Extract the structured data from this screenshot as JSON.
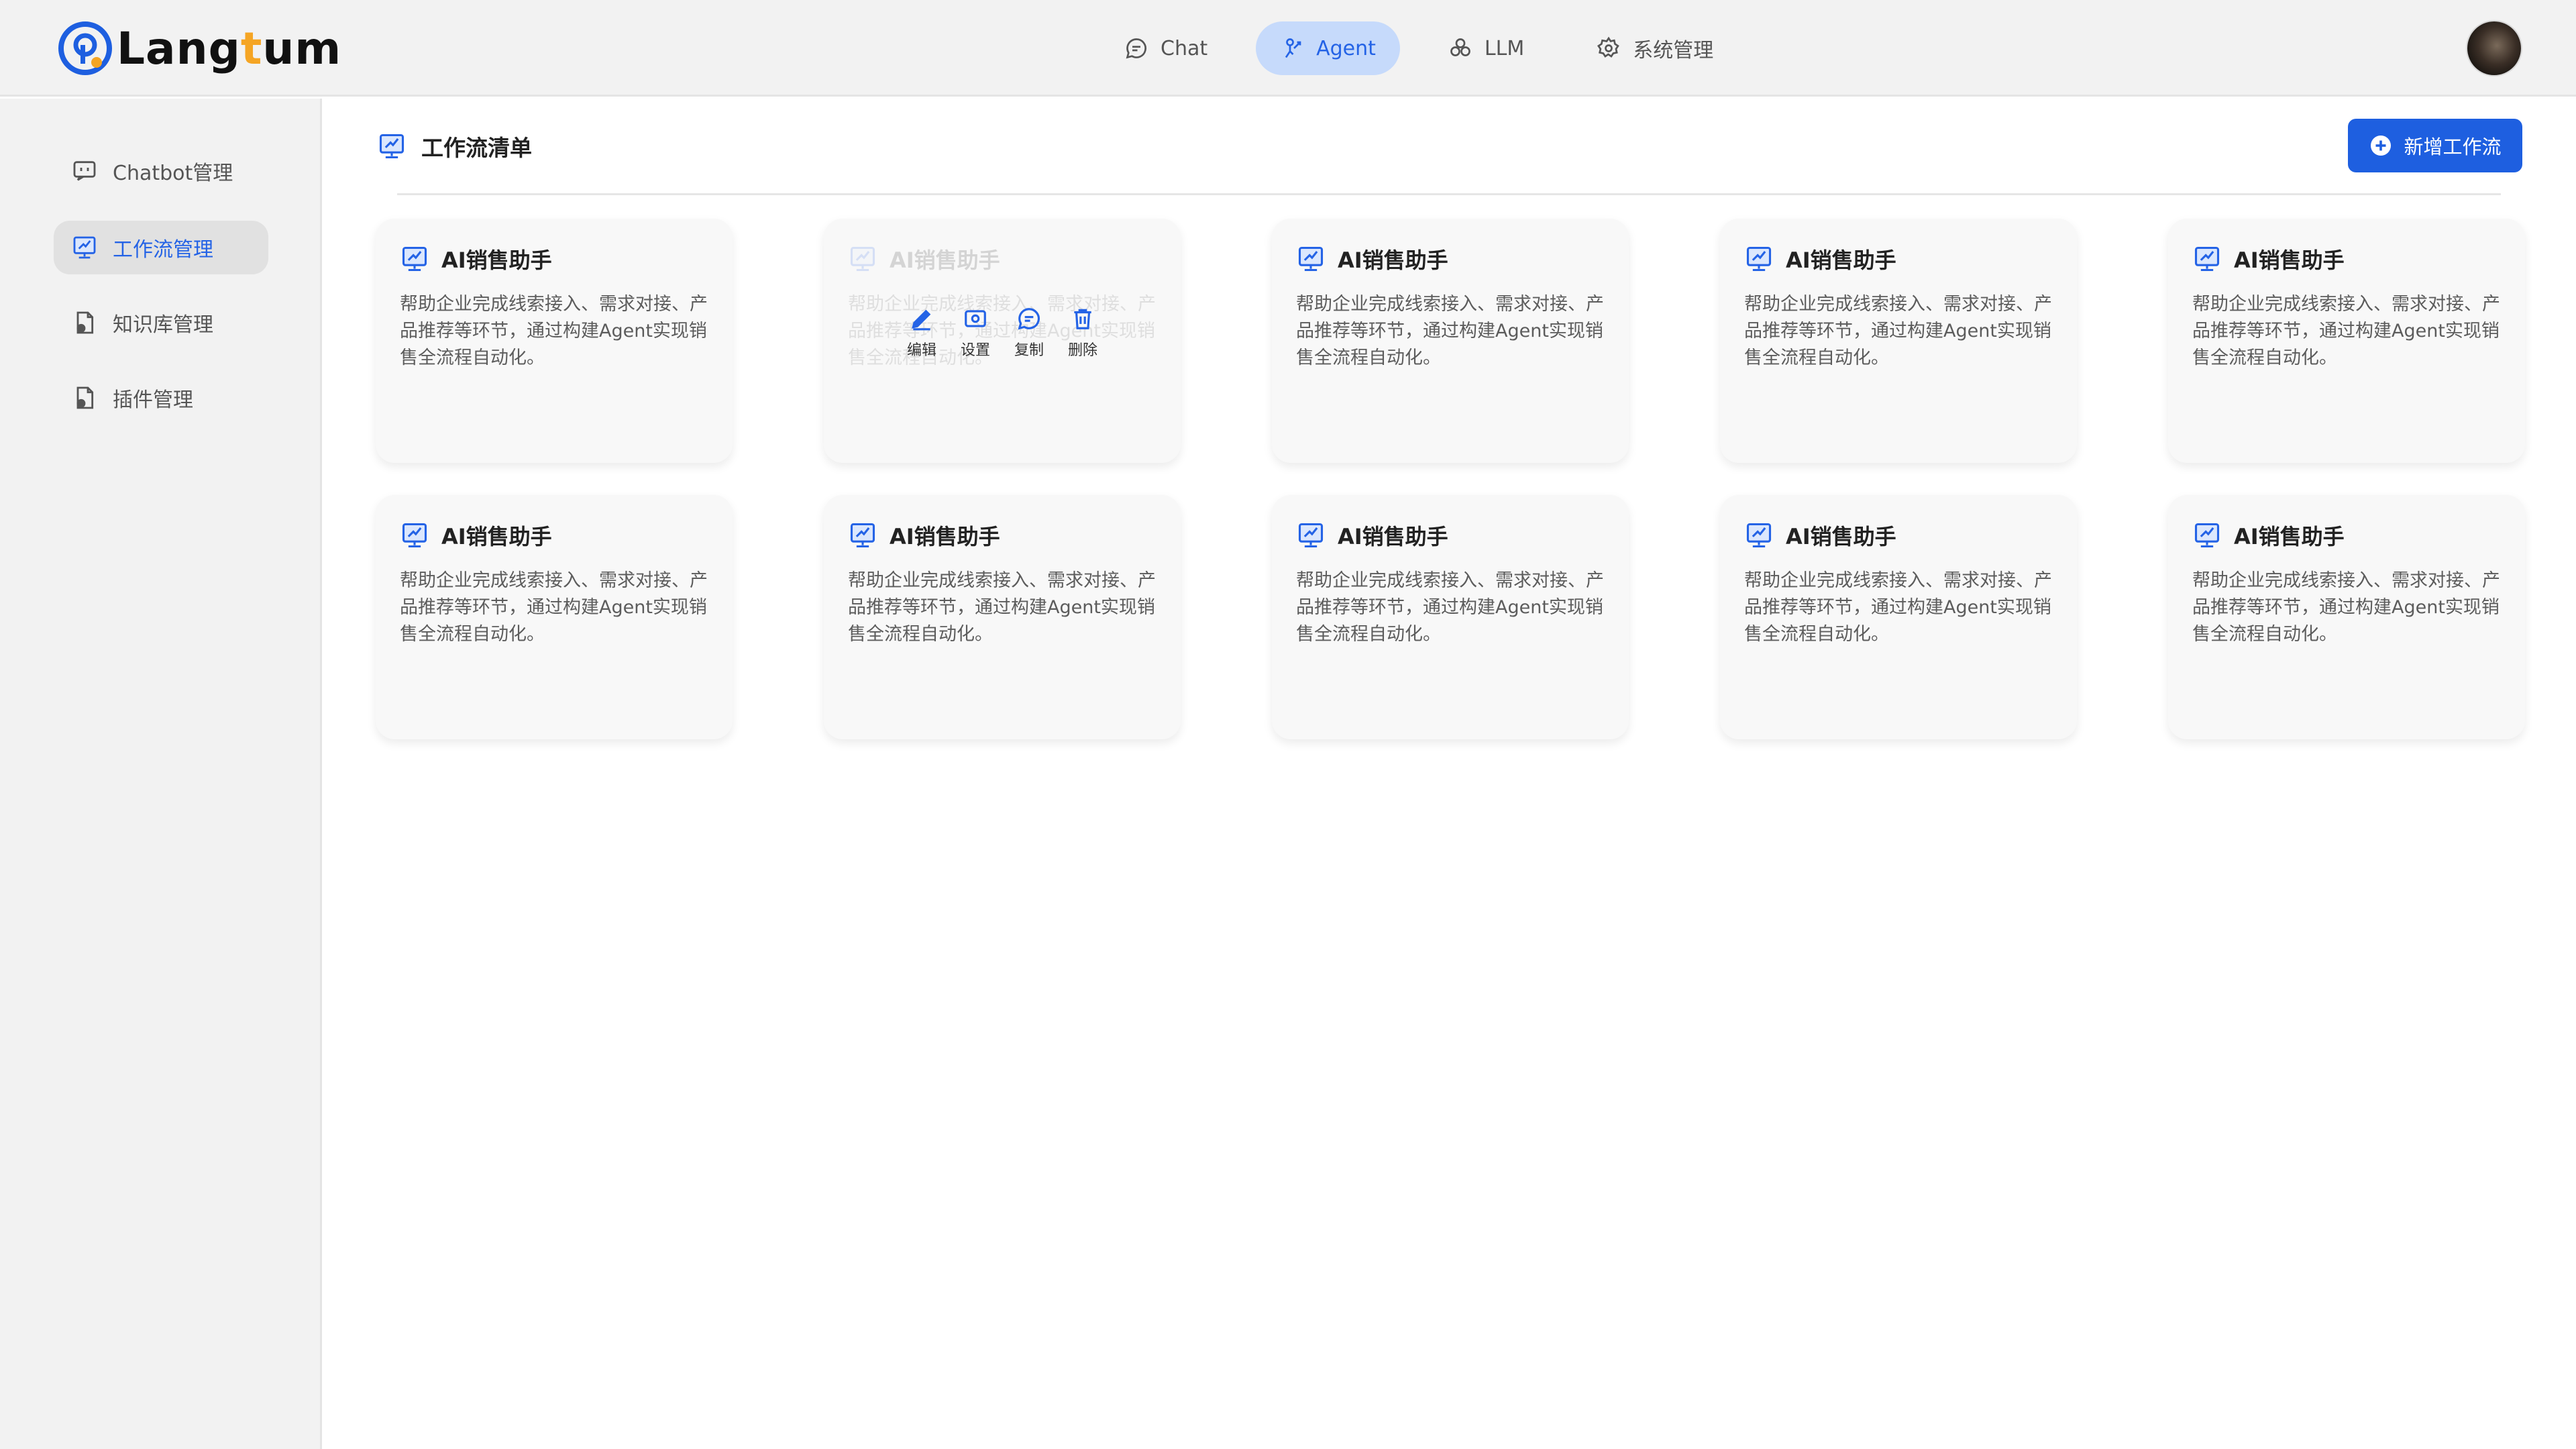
{
  "app": {
    "logo_text_main": "Lang",
    "logo_text_accent": "t",
    "logo_text_tail": "um"
  },
  "nav": {
    "items": [
      {
        "label": "Chat",
        "icon": "chat-bubble-icon"
      },
      {
        "label": "Agent",
        "icon": "agent-icon",
        "active": true
      },
      {
        "label": "LLM",
        "icon": "cluster-icon"
      },
      {
        "label": "系统管理",
        "icon": "gear-icon"
      }
    ]
  },
  "sidebar": {
    "items": [
      {
        "label": "Chatbot管理",
        "icon": "chatbot-icon"
      },
      {
        "label": "工作流管理",
        "icon": "workflow-icon",
        "active": true
      },
      {
        "label": "知识库管理",
        "icon": "knowledge-base-icon"
      },
      {
        "label": "插件管理",
        "icon": "plugin-icon"
      }
    ]
  },
  "main": {
    "title": "工作流清单",
    "add_button_label": "新增工作流"
  },
  "card_actions": {
    "edit": "编辑",
    "settings": "设置",
    "copy": "复制",
    "delete": "删除"
  },
  "cards": [
    {
      "title": "AI销售助手",
      "desc": "帮助企业完成线索接入、需求对接、产品推荐等环节，通过构建Agent实现销售全流程自动化。"
    },
    {
      "title": "AI销售助手",
      "desc": "帮助企业完成线索接入、需求对接、产品推荐等环节，通过构建Agent实现销售全流程自动化。",
      "hovered": true
    },
    {
      "title": "AI销售助手",
      "desc": "帮助企业完成线索接入、需求对接、产品推荐等环节，通过构建Agent实现销售全流程自动化。"
    },
    {
      "title": "AI销售助手",
      "desc": "帮助企业完成线索接入、需求对接、产品推荐等环节，通过构建Agent实现销售全流程自动化。"
    },
    {
      "title": "AI销售助手",
      "desc": "帮助企业完成线索接入、需求对接、产品推荐等环节，通过构建Agent实现销售全流程自动化。"
    },
    {
      "title": "AI销售助手",
      "desc": "帮助企业完成线索接入、需求对接、产品推荐等环节，通过构建Agent实现销售全流程自动化。"
    },
    {
      "title": "AI销售助手",
      "desc": "帮助企业完成线索接入、需求对接、产品推荐等环节，通过构建Agent实现销售全流程自动化。"
    },
    {
      "title": "AI销售助手",
      "desc": "帮助企业完成线索接入、需求对接、产品推荐等环节，通过构建Agent实现销售全流程自动化。"
    },
    {
      "title": "AI销售助手",
      "desc": "帮助企业完成线索接入、需求对接、产品推荐等环节，通过构建Agent实现销售全流程自动化。"
    },
    {
      "title": "AI销售助手",
      "desc": "帮助企业完成线索接入、需求对接、产品推荐等环节，通过构建Agent实现销售全流程自动化。"
    }
  ],
  "colors": {
    "accent": "#1e5fe0",
    "nav_active_bg": "#c6dafb",
    "logo_accent": "#f5a524"
  }
}
